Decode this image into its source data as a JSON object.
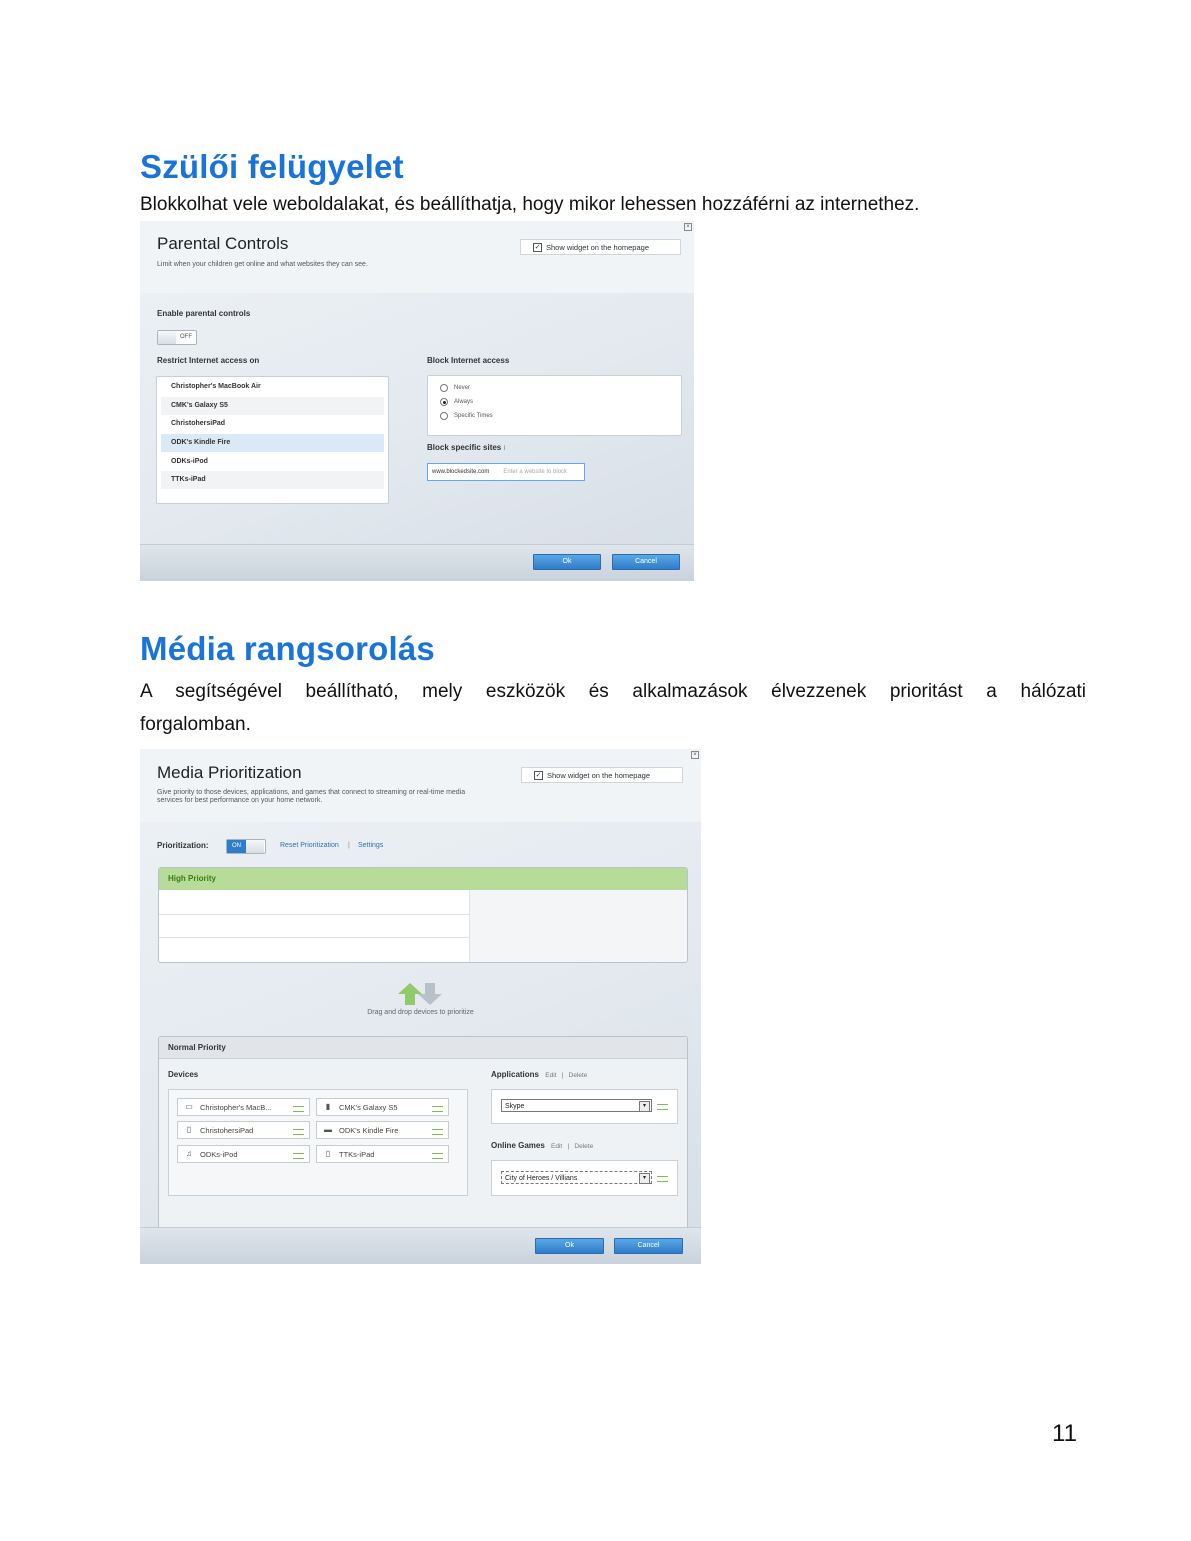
{
  "section1": {
    "heading": "Szülői felügyelet",
    "description": "Blokkolhat vele weboldalakat, és beállíthatja, hogy mikor lehessen hozzáférni az internethez."
  },
  "parental": {
    "title": "Parental Controls",
    "subtitle": "Limit when your children get online and what websites they can see.",
    "widget_label": "Show widget on the homepage",
    "widget_checked": true,
    "enable_label": "Enable parental controls",
    "toggle_state": "OFF",
    "restrict_label": "Restrict Internet access on",
    "devices": [
      "Christopher's MacBook Air",
      "CMK's Galaxy S5",
      "ChristohersiPad",
      "ODK's Kindle Fire",
      "ODKs-iPod",
      "TTKs-iPad"
    ],
    "selected_device": "ODK's Kindle Fire",
    "block_label": "Block Internet access",
    "radio_options": [
      "Never",
      "Always",
      "Specific Times"
    ],
    "radio_selected": "Always",
    "sites_label": "Block specific sites",
    "site_value": "www.blockedsite.com",
    "site_placeholder": "Enter a website to block",
    "ok_label": "Ok",
    "cancel_label": "Cancel"
  },
  "section2": {
    "heading": "Média rangsorolás",
    "description_line1": "A segítségével beállítható, mely eszközök és alkalmazások élvezzenek prioritást a hálózati",
    "description_line2": "forgalomban."
  },
  "media": {
    "title": "Media Prioritization",
    "subtitle_line1": "Give priority to those devices, applications, and games that connect to streaming or real-time media",
    "subtitle_line2": "services for best performance on your home network.",
    "widget_label": "Show widget on the homepage",
    "widget_checked": true,
    "prioritization_label": "Prioritization:",
    "toggle_state": "ON",
    "reset_link": "Reset Prioritization",
    "settings_link": "Settings",
    "separator": "|",
    "high_priority_label": "High Priority",
    "drag_hint": "Drag and drop devices to prioritize",
    "normal_priority_label": "Normal Priority",
    "devices_label": "Devices",
    "devices": [
      {
        "name": "Christopher's MacB...",
        "icon": "laptop-icon"
      },
      {
        "name": "CMK's Galaxy S5",
        "icon": "phone-icon"
      },
      {
        "name": "ChristohersiPad",
        "icon": "tablet-icon"
      },
      {
        "name": "ODK's Kindle Fire",
        "icon": "ereader-icon"
      },
      {
        "name": "ODKs-iPod",
        "icon": "music-player-icon"
      },
      {
        "name": "TTKs-iPad",
        "icon": "tablet-icon"
      }
    ],
    "applications_label": "Applications",
    "online_games_label": "Online Games",
    "edit_label": "Edit",
    "delete_label": "Delete",
    "application_value": "Skype",
    "game_value": "City of Heroes / Villians",
    "ok_label": "Ok",
    "cancel_label": "Cancel"
  },
  "page_number": "11",
  "colors": {
    "heading": "#1a73d9",
    "high_priority": "#b7dc9a",
    "button": "#2e7dc8"
  }
}
